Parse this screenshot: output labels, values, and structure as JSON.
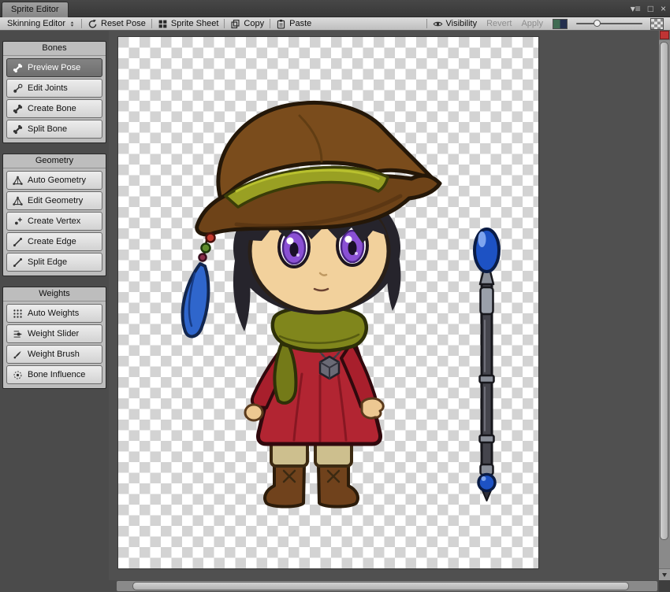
{
  "window": {
    "tab_title": "Sprite Editor",
    "controls": {
      "menu": "▾≡",
      "maximize": "□",
      "close": "×"
    }
  },
  "toolbar": {
    "mode": "Skinning Editor",
    "reset_pose": "Reset Pose",
    "sprite_sheet": "Sprite Sheet",
    "copy": "Copy",
    "paste": "Paste",
    "visibility": "Visibility",
    "revert": "Revert",
    "apply": "Apply",
    "zoom_slider_position": 0.26
  },
  "sidebar": {
    "panels": [
      {
        "title": "Bones",
        "buttons": [
          {
            "label": "Preview Pose",
            "icon": "bone-icon",
            "active": true
          },
          {
            "label": "Edit Joints",
            "icon": "joint-icon",
            "active": false
          },
          {
            "label": "Create Bone",
            "icon": "bone-icon",
            "active": false
          },
          {
            "label": "Split Bone",
            "icon": "bone-icon",
            "active": false
          }
        ]
      },
      {
        "title": "Geometry",
        "buttons": [
          {
            "label": "Auto Geometry",
            "icon": "mesh-icon",
            "active": false
          },
          {
            "label": "Edit Geometry",
            "icon": "mesh-icon",
            "active": false
          },
          {
            "label": "Create Vertex",
            "icon": "vertex-icon",
            "active": false
          },
          {
            "label": "Create Edge",
            "icon": "edge-icon",
            "active": false
          },
          {
            "label": "Split Edge",
            "icon": "edge-icon",
            "active": false
          }
        ]
      },
      {
        "title": "Weights",
        "buttons": [
          {
            "label": "Auto Weights",
            "icon": "weights-icon",
            "active": false
          },
          {
            "label": "Weight Slider",
            "icon": "slider-icon",
            "active": false
          },
          {
            "label": "Weight Brush",
            "icon": "brush-icon",
            "active": false
          },
          {
            "label": "Bone Influence",
            "icon": "influence-icon",
            "active": false
          }
        ]
      }
    ]
  },
  "canvas": {
    "sprite_description": "chibi witch character sprite with brown hat, blue feather charm, red dress, green scarf, boots, and a blue-orb staff"
  },
  "colors": {
    "toolbar_bg": "#c8c8c8",
    "panel_bg": "#bdbdbd",
    "active_button_bg": "#787878",
    "editor_bg": "#505050",
    "checker_light": "#ffffff",
    "checker_dark": "#d3d3d3",
    "scrollbar_red": "#c03434",
    "hat_brown": "#7a4c1c",
    "hat_band_olive": "#99a023",
    "dress_red": "#b22532",
    "scarf_olive": "#80861c",
    "hair_black": "#26242c",
    "skin": "#f2d19c",
    "eye_purple": "#8a50d4",
    "staff_orb_blue": "#1d52c4"
  }
}
